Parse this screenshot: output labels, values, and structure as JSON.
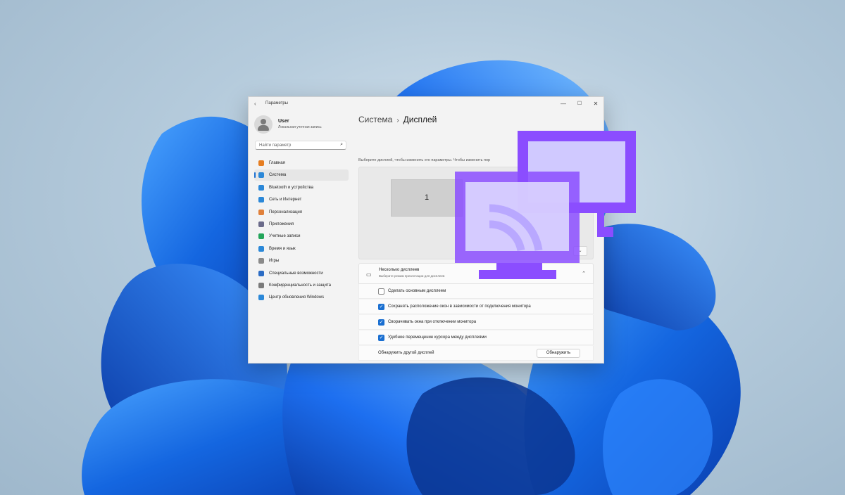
{
  "window": {
    "app_title": "Параметры",
    "back_glyph": "‹",
    "minimize_glyph": "—",
    "maximize_glyph": "☐",
    "close_glyph": "✕"
  },
  "user": {
    "name": "User",
    "subtitle": "Локальная учетная запись"
  },
  "search": {
    "placeholder": "Найти параметр",
    "icon": "search-icon"
  },
  "sidebar": {
    "items": [
      {
        "label": "Главная",
        "icon": "home-icon",
        "color": "#e67e22",
        "active": false
      },
      {
        "label": "Система",
        "icon": "monitor-icon",
        "color": "#2b88d8",
        "active": true
      },
      {
        "label": "Bluetooth и устройства",
        "icon": "bluetooth-icon",
        "color": "#2b88d8",
        "active": false
      },
      {
        "label": "Сеть и Интернет",
        "icon": "wifi-icon",
        "color": "#2b88d8",
        "active": false
      },
      {
        "label": "Персонализация",
        "icon": "brush-icon",
        "color": "#e0803a",
        "active": false
      },
      {
        "label": "Приложения",
        "icon": "apps-icon",
        "color": "#6b6b8a",
        "active": false
      },
      {
        "label": "Учетные записи",
        "icon": "account-icon",
        "color": "#23a55a",
        "active": false
      },
      {
        "label": "Время и язык",
        "icon": "globe-icon",
        "color": "#2b88d8",
        "active": false
      },
      {
        "label": "Игры",
        "icon": "gamepad-icon",
        "color": "#8a8a8a",
        "active": false
      },
      {
        "label": "Специальные возможности",
        "icon": "accessibility-icon",
        "color": "#2b6cc4",
        "active": false
      },
      {
        "label": "Конфиденциальность и защита",
        "icon": "shield-icon",
        "color": "#7a7a7a",
        "active": false
      },
      {
        "label": "Центр обновления Windows",
        "icon": "update-icon",
        "color": "#2b88d8",
        "active": false
      }
    ]
  },
  "main": {
    "breadcrumb_parent": "Система",
    "breadcrumb_sep": "›",
    "breadcrumb_current": "Дисплей",
    "intro": "Выберите дисплей, чтобы изменить его параметры. Чтобы изменить пор",
    "monitor_label": "1",
    "dropdown_glyph": "⌄",
    "multi": {
      "title": "Несколько дисплеев",
      "subtitle": "Выберите режим презентации для дисплеев",
      "chevron": "⌃",
      "options": [
        {
          "label": "Сделать основным дисплеем",
          "checked": false
        },
        {
          "label": "Сохранять расположение окон в зависимости от подключения монитора",
          "checked": true
        },
        {
          "label": "Сворачивать окна при отключении монитора",
          "checked": true
        },
        {
          "label": "Удобное перемещение курсора между дисплеями",
          "checked": true
        }
      ],
      "detect_label": "Обнаружить другой дисплей",
      "detect_button": "Обнаружить"
    }
  },
  "colors": {
    "accent": "#1a6fd1",
    "overlay_purple": "#8b4dff",
    "overlay_purple_dark": "#7a3bf0",
    "overlay_fill": "#dcd6ff"
  }
}
